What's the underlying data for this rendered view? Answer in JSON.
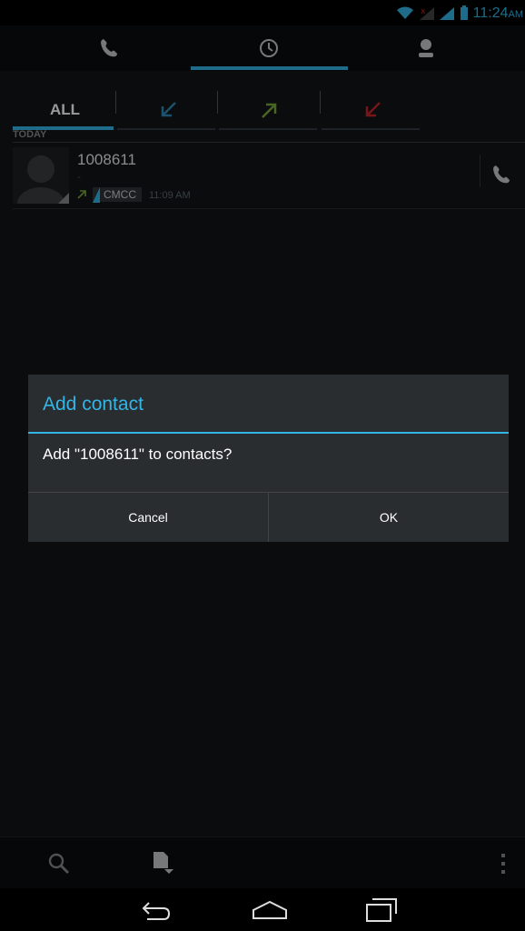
{
  "status_bar": {
    "time": "11:24",
    "ampm": "AM",
    "icons": [
      "wifi-icon",
      "signal-no-sim-icon",
      "signal-icon",
      "battery-icon"
    ]
  },
  "top_tabs": [
    {
      "icon": "phone-icon",
      "selected": false
    },
    {
      "icon": "clock-icon",
      "selected": true
    },
    {
      "icon": "contact-icon",
      "selected": false
    }
  ],
  "filter_tabs": [
    {
      "label": "ALL",
      "selected": true
    },
    {
      "icon": "incoming-call-icon",
      "color": "#2f88b3"
    },
    {
      "icon": "outgoing-call-icon",
      "color": "#7aa83a"
    },
    {
      "icon": "missed-call-icon",
      "color": "#c8242b"
    }
  ],
  "call_log": {
    "section": "TODAY",
    "items": [
      {
        "number": "1008611",
        "label": "-",
        "carrier": "CMCC",
        "time": "11:09 AM",
        "type": "outgoing"
      }
    ]
  },
  "dialog": {
    "title": "Add contact",
    "message": "Add \"1008611\" to contacts?",
    "cancel": "Cancel",
    "ok": "OK"
  },
  "colors": {
    "accent": "#33b5e5"
  }
}
